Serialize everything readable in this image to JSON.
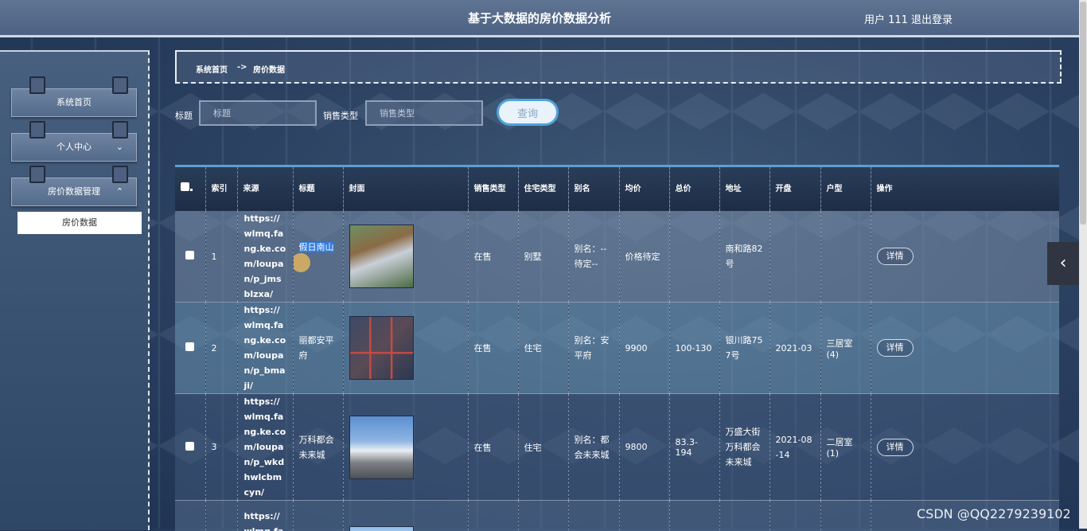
{
  "app": {
    "title": "基于大数据的房价数据分析",
    "user_label": "用户 111",
    "logout_label": "退出登录"
  },
  "sidebar": {
    "items": [
      {
        "label": "系统首页"
      },
      {
        "label": "个人中心",
        "chevron": "⌄"
      },
      {
        "label": "房价数据管理",
        "chevron": "⌃"
      }
    ],
    "submenu": [
      {
        "label": "房价数据"
      }
    ]
  },
  "breadcrumb": {
    "home": "系统首页",
    "separator": "->",
    "current": "房价数据"
  },
  "search": {
    "title_label": "标题",
    "title_placeholder": "标题",
    "sales_label": "销售类型",
    "sales_placeholder": "销售类型",
    "query_button": "查询"
  },
  "table": {
    "columns": {
      "index": "索引",
      "source": "来源",
      "title": "标题",
      "cover": "封面",
      "sales_type": "销售类型",
      "house_type": "住宅类型",
      "alias": "别名",
      "avg_price": "均价",
      "total_price": "总价",
      "address": "地址",
      "opening": "开盘",
      "layout": "户型",
      "action": "操作"
    },
    "rows": [
      {
        "index": "1",
        "source": "https://wlmq.fang.ke.com/loupan/p_jmsblzxa/",
        "title_highlight": "假日南山",
        "sales_type": "在售",
        "house_type": "别墅",
        "alias": "别名：--待定--",
        "avg_price": "价格待定",
        "total_price": "",
        "address": "南和路82号",
        "opening": "",
        "layout": "",
        "action": "详情"
      },
      {
        "index": "2",
        "source": "https://wlmq.fang.ke.com/loupan/p_bmaji/",
        "title": "丽都安平府",
        "sales_type": "在售",
        "house_type": "住宅",
        "alias": "别名：安平府",
        "avg_price": "9900",
        "total_price": "100-130",
        "address": "银川路757号",
        "opening": "2021-03",
        "layout": "三居室(4)",
        "action": "详情"
      },
      {
        "index": "3",
        "source": "https://wlmq.fang.ke.com/loupan/p_wkdhwlcbmcyn/",
        "title": "万科都会未来城",
        "sales_type": "在售",
        "house_type": "住宅",
        "alias": "别名：都会未来城",
        "avg_price": "9800",
        "total_price": "83.3-194",
        "address": "万盛大街万科都会未来城",
        "opening": "2021-08-14",
        "layout": "二居室(1)",
        "action": "详情"
      },
      {
        "source": "https://wlmq.fang.k"
      }
    ]
  },
  "watermark": "CSDN @QQ2279239102",
  "icons": {
    "collapse": "‹"
  }
}
